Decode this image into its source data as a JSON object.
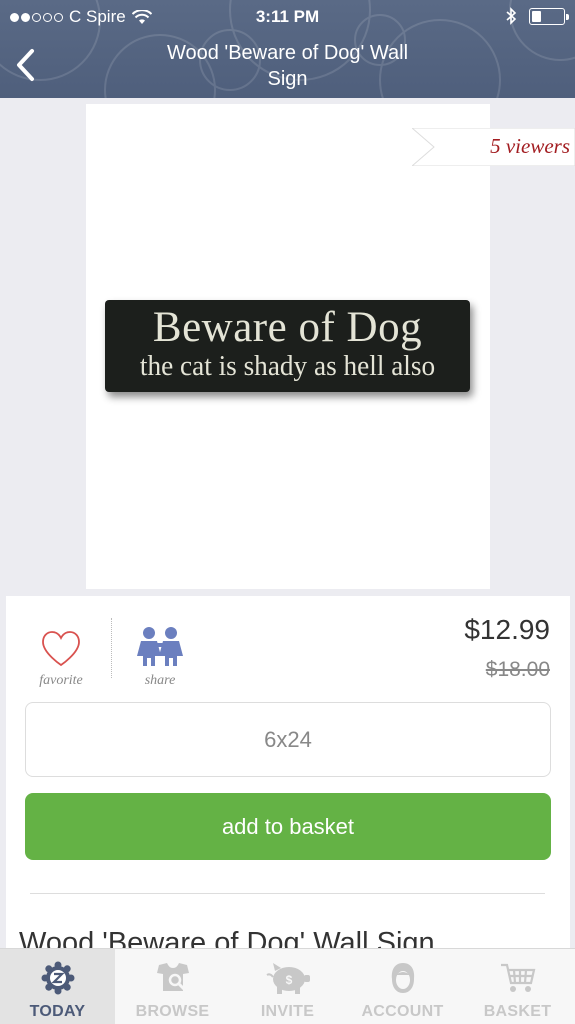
{
  "status_bar": {
    "carrier": "C Spire",
    "time": "3:11 PM"
  },
  "nav": {
    "title_line1": "Wood 'Beware of Dog' Wall",
    "title_line2": "Sign"
  },
  "product_image": {
    "viewers": "5 viewers",
    "sign_line1": "Beware of Dog",
    "sign_line2": "the cat is shady as hell also"
  },
  "actions": {
    "favorite_label": "favorite",
    "share_label": "share"
  },
  "pricing": {
    "price": "$12.99",
    "original_price": "$18.00"
  },
  "size_option": "6x24",
  "add_button_label": "add to basket",
  "description_title": "Wood 'Beware of Dog' Wall Sign",
  "tabs": [
    {
      "label": "TODAY",
      "icon": "zulily-badge-icon",
      "active": true
    },
    {
      "label": "BROWSE",
      "icon": "browse-icon",
      "active": false
    },
    {
      "label": "INVITE",
      "icon": "piggy-bank-icon",
      "active": false
    },
    {
      "label": "ACCOUNT",
      "icon": "account-icon",
      "active": false
    },
    {
      "label": "BASKET",
      "icon": "basket-icon",
      "active": false
    }
  ],
  "colors": {
    "header": "#53627f",
    "add_button": "#64b245",
    "viewers_text": "#a31e22",
    "share_icon": "#6b7fbf",
    "favorite_icon": "#d9524f",
    "active_tab": "#4c5a78"
  }
}
